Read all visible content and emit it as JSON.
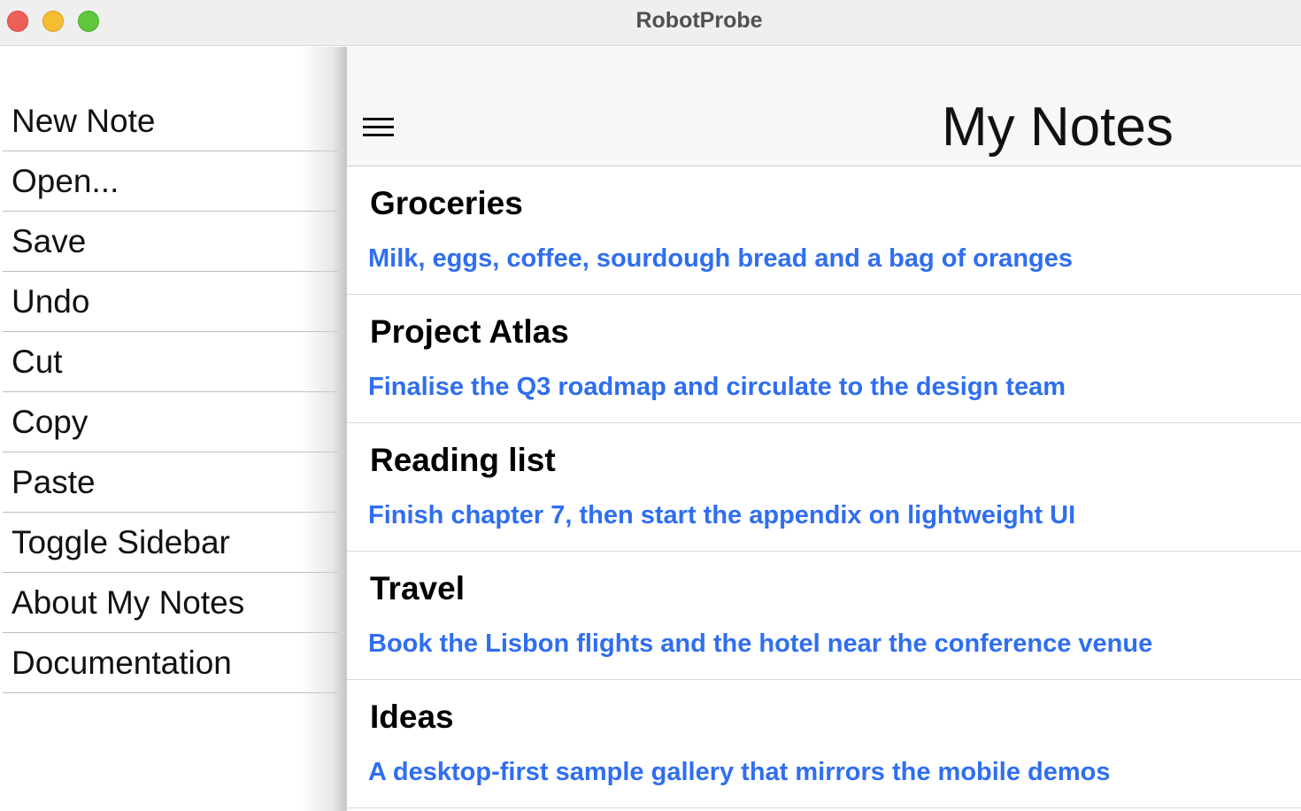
{
  "window": {
    "title": "RobotProbe"
  },
  "sidebar": {
    "items": [
      {
        "label": "New Note"
      },
      {
        "label": "Open..."
      },
      {
        "label": "Save"
      },
      {
        "label": "Undo"
      },
      {
        "label": "Cut"
      },
      {
        "label": "Copy"
      },
      {
        "label": "Paste"
      },
      {
        "label": "Toggle Sidebar"
      },
      {
        "label": "About My Notes"
      },
      {
        "label": "Documentation"
      }
    ]
  },
  "header": {
    "title": "My Notes",
    "menu_icon": "hamburger-menu-icon"
  },
  "notes": [
    {
      "title": "Groceries",
      "body": "Milk, eggs, coffee, sourdough bread and a bag of oranges"
    },
    {
      "title": "Project Atlas",
      "body": "Finalise the Q3 roadmap and circulate to the design team"
    },
    {
      "title": "Reading list",
      "body": "Finish chapter 7, then start the appendix on lightweight UI"
    },
    {
      "title": "Travel",
      "body": "Book the Lisbon flights and the hotel near the conference venue"
    },
    {
      "title": "Ideas",
      "body": "A desktop-first sample gallery that mirrors the mobile demos"
    }
  ],
  "colors": {
    "accent": "#2f6ef0",
    "close": "#ee5f57",
    "minimize": "#f5bd30",
    "zoom": "#5fc73e"
  }
}
